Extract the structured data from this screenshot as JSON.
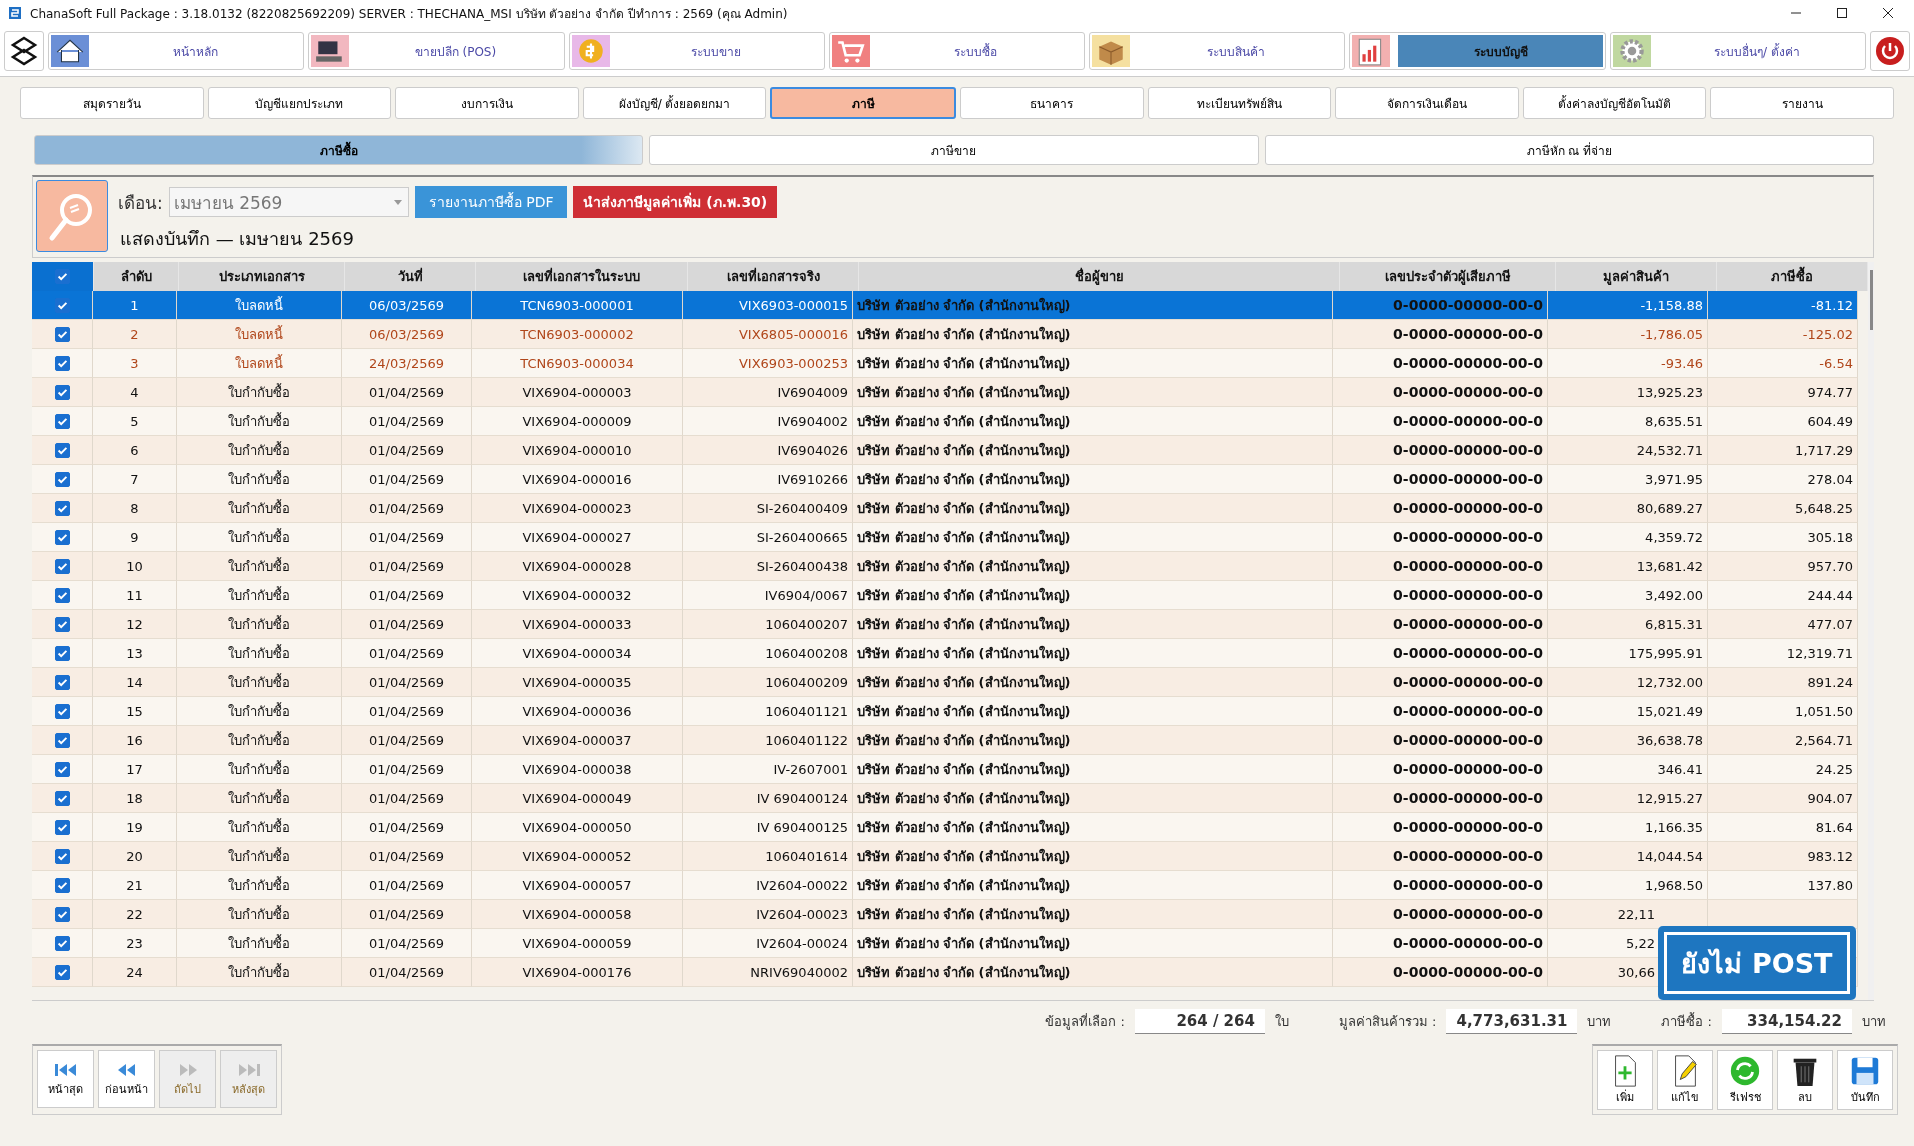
{
  "window": {
    "title": "ChanaSoft Full Package : 3.18.0132 (8220825692209) SERVER : THECHANA_MSI บริษัท ตัวอย่าง จำกัด ปีทำการ : 2569 (คุณ Admin)"
  },
  "modules": [
    {
      "label": "หน้าหลัก",
      "kind": "home",
      "selected": false
    },
    {
      "label": "ขายปลีก (POS)",
      "kind": "pos",
      "selected": false
    },
    {
      "label": "ระบบขาย",
      "kind": "sales",
      "selected": false
    },
    {
      "label": "ระบบซื้อ",
      "kind": "purchase",
      "selected": false
    },
    {
      "label": "ระบบสินค้า",
      "kind": "stock",
      "selected": false
    },
    {
      "label": "ระบบบัญชี",
      "kind": "account",
      "selected": true
    },
    {
      "label": "ระบบอื่นๆ/ ตั้งค่า",
      "kind": "settings",
      "selected": false
    }
  ],
  "sub_tabs": [
    {
      "label": "สมุดรายวัน",
      "selected": false
    },
    {
      "label": "บัญชีแยกประเภท",
      "selected": false
    },
    {
      "label": "งบการเงิน",
      "selected": false
    },
    {
      "label": "ผังบัญชี/ ตั้งยอดยกมา",
      "selected": false
    },
    {
      "label": "ภาษี",
      "selected": true
    },
    {
      "label": "ธนาคาร",
      "selected": false
    },
    {
      "label": "ทะเบียนทรัพย์สิน",
      "selected": false
    },
    {
      "label": "จัดการเงินเดือน",
      "selected": false
    },
    {
      "label": "ตั้งค่าลงบัญชีอัตโนมัติ",
      "selected": false
    },
    {
      "label": "รายงาน",
      "selected": false
    }
  ],
  "tax_tabs": [
    {
      "label": "ภาษีซื้อ",
      "selected": true
    },
    {
      "label": "ภาษีขาย",
      "selected": false
    },
    {
      "label": "ภาษีหัก ณ ที่จ่าย",
      "selected": false
    }
  ],
  "filter": {
    "month_label": "เดือน:",
    "month": "เมษายน 2569",
    "pdf_button": "รายงานภาษีซื้อ PDF",
    "submit_button": "นำส่งภาษีมูลค่าเพิ่ม (ภ.พ.30)",
    "heading": "แสดงบันทึก — เมษายน 2569"
  },
  "table": {
    "all_checked": true,
    "columns": [
      "ลำดับ",
      "ประเภทเอกสาร",
      "วันที่",
      "เลขที่เอกสารในระบบ",
      "เลขที่เอกสารจริง",
      "ชื่อผู้ขาย",
      "เลขประจำตัวผู้เสียภาษี",
      "มูลค่าสินค้า",
      "ภาษีซื้อ"
    ],
    "rows": [
      {
        "checked": true,
        "selected": true,
        "kind": "credit",
        "no": "1",
        "type": "ใบลดหนี้",
        "date": "06/03/2569",
        "doc": "TCN6903-000001",
        "ref": "VIX6903-000015",
        "vendor": "บริษัท ตัวอย่าง จำกัด (สำนักงานใหญ่)",
        "tax_id": "0-0000-00000-00-0",
        "amount": "-1,158.88",
        "vat": "-81.12"
      },
      {
        "checked": true,
        "selected": false,
        "kind": "credit",
        "no": "2",
        "type": "ใบลดหนี้",
        "date": "06/03/2569",
        "doc": "TCN6903-000002",
        "ref": "VIX6805-000016",
        "vendor": "บริษัท ตัวอย่าง จำกัด (สำนักงานใหญ่)",
        "tax_id": "0-0000-00000-00-0",
        "amount": "-1,786.05",
        "vat": "-125.02"
      },
      {
        "checked": true,
        "selected": false,
        "kind": "credit",
        "no": "3",
        "type": "ใบลดหนี้",
        "date": "24/03/2569",
        "doc": "TCN6903-000034",
        "ref": "VIX6903-000253",
        "vendor": "บริษัท ตัวอย่าง จำกัด (สำนักงานใหญ่)",
        "tax_id": "0-0000-00000-00-0",
        "amount": "-93.46",
        "vat": "-6.54"
      },
      {
        "checked": true,
        "selected": false,
        "kind": "invoice",
        "no": "4",
        "type": "ใบกำกับซื้อ",
        "date": "01/04/2569",
        "doc": "VIX6904-000003",
        "ref": "IV6904009",
        "vendor": "บริษัท ตัวอย่าง จำกัด (สำนักงานใหญ่)",
        "tax_id": "0-0000-00000-00-0",
        "amount": "13,925.23",
        "vat": "974.77"
      },
      {
        "checked": true,
        "selected": false,
        "kind": "invoice",
        "no": "5",
        "type": "ใบกำกับซื้อ",
        "date": "01/04/2569",
        "doc": "VIX6904-000009",
        "ref": "IV6904002",
        "vendor": "บริษัท ตัวอย่าง จำกัด (สำนักงานใหญ่)",
        "tax_id": "0-0000-00000-00-0",
        "amount": "8,635.51",
        "vat": "604.49"
      },
      {
        "checked": true,
        "selected": false,
        "kind": "invoice",
        "no": "6",
        "type": "ใบกำกับซื้อ",
        "date": "01/04/2569",
        "doc": "VIX6904-000010",
        "ref": "IV6904026",
        "vendor": "บริษัท ตัวอย่าง จำกัด (สำนักงานใหญ่)",
        "tax_id": "0-0000-00000-00-0",
        "amount": "24,532.71",
        "vat": "1,717.29"
      },
      {
        "checked": true,
        "selected": false,
        "kind": "invoice",
        "no": "7",
        "type": "ใบกำกับซื้อ",
        "date": "01/04/2569",
        "doc": "VIX6904-000016",
        "ref": "IV6910266",
        "vendor": "บริษัท ตัวอย่าง จำกัด (สำนักงานใหญ่)",
        "tax_id": "0-0000-00000-00-0",
        "amount": "3,971.95",
        "vat": "278.04"
      },
      {
        "checked": true,
        "selected": false,
        "kind": "invoice",
        "no": "8",
        "type": "ใบกำกับซื้อ",
        "date": "01/04/2569",
        "doc": "VIX6904-000023",
        "ref": "SI-260400409",
        "vendor": "บริษัท ตัวอย่าง จำกัด (สำนักงานใหญ่)",
        "tax_id": "0-0000-00000-00-0",
        "amount": "80,689.27",
        "vat": "5,648.25"
      },
      {
        "checked": true,
        "selected": false,
        "kind": "invoice",
        "no": "9",
        "type": "ใบกำกับซื้อ",
        "date": "01/04/2569",
        "doc": "VIX6904-000027",
        "ref": "SI-260400665",
        "vendor": "บริษัท ตัวอย่าง จำกัด (สำนักงานใหญ่)",
        "tax_id": "0-0000-00000-00-0",
        "amount": "4,359.72",
        "vat": "305.18"
      },
      {
        "checked": true,
        "selected": false,
        "kind": "invoice",
        "no": "10",
        "type": "ใบกำกับซื้อ",
        "date": "01/04/2569",
        "doc": "VIX6904-000028",
        "ref": "SI-260400438",
        "vendor": "บริษัท ตัวอย่าง จำกัด (สำนักงานใหญ่)",
        "tax_id": "0-0000-00000-00-0",
        "amount": "13,681.42",
        "vat": "957.70"
      },
      {
        "checked": true,
        "selected": false,
        "kind": "invoice",
        "no": "11",
        "type": "ใบกำกับซื้อ",
        "date": "01/04/2569",
        "doc": "VIX6904-000032",
        "ref": "IV6904/0067",
        "vendor": "บริษัท ตัวอย่าง จำกัด (สำนักงานใหญ่)",
        "tax_id": "0-0000-00000-00-0",
        "amount": "3,492.00",
        "vat": "244.44"
      },
      {
        "checked": true,
        "selected": false,
        "kind": "invoice",
        "no": "12",
        "type": "ใบกำกับซื้อ",
        "date": "01/04/2569",
        "doc": "VIX6904-000033",
        "ref": "1060400207",
        "vendor": "บริษัท ตัวอย่าง จำกัด (สำนักงานใหญ่)",
        "tax_id": "0-0000-00000-00-0",
        "amount": "6,815.31",
        "vat": "477.07"
      },
      {
        "checked": true,
        "selected": false,
        "kind": "invoice",
        "no": "13",
        "type": "ใบกำกับซื้อ",
        "date": "01/04/2569",
        "doc": "VIX6904-000034",
        "ref": "1060400208",
        "vendor": "บริษัท ตัวอย่าง จำกัด (สำนักงานใหญ่)",
        "tax_id": "0-0000-00000-00-0",
        "amount": "175,995.91",
        "vat": "12,319.71"
      },
      {
        "checked": true,
        "selected": false,
        "kind": "invoice",
        "no": "14",
        "type": "ใบกำกับซื้อ",
        "date": "01/04/2569",
        "doc": "VIX6904-000035",
        "ref": "1060400209",
        "vendor": "บริษัท ตัวอย่าง จำกัด (สำนักงานใหญ่)",
        "tax_id": "0-0000-00000-00-0",
        "amount": "12,732.00",
        "vat": "891.24"
      },
      {
        "checked": true,
        "selected": false,
        "kind": "invoice",
        "no": "15",
        "type": "ใบกำกับซื้อ",
        "date": "01/04/2569",
        "doc": "VIX6904-000036",
        "ref": "1060401121",
        "vendor": "บริษัท ตัวอย่าง จำกัด (สำนักงานใหญ่)",
        "tax_id": "0-0000-00000-00-0",
        "amount": "15,021.49",
        "vat": "1,051.50"
      },
      {
        "checked": true,
        "selected": false,
        "kind": "invoice",
        "no": "16",
        "type": "ใบกำกับซื้อ",
        "date": "01/04/2569",
        "doc": "VIX6904-000037",
        "ref": "1060401122",
        "vendor": "บริษัท ตัวอย่าง จำกัด (สำนักงานใหญ่)",
        "tax_id": "0-0000-00000-00-0",
        "amount": "36,638.78",
        "vat": "2,564.71"
      },
      {
        "checked": true,
        "selected": false,
        "kind": "invoice",
        "no": "17",
        "type": "ใบกำกับซื้อ",
        "date": "01/04/2569",
        "doc": "VIX6904-000038",
        "ref": "IV-2607001",
        "vendor": "บริษัท ตัวอย่าง จำกัด (สำนักงานใหญ่)",
        "tax_id": "0-0000-00000-00-0",
        "amount": "346.41",
        "vat": "24.25"
      },
      {
        "checked": true,
        "selected": false,
        "kind": "invoice",
        "no": "18",
        "type": "ใบกำกับซื้อ",
        "date": "01/04/2569",
        "doc": "VIX6904-000049",
        "ref": "IV 690400124",
        "vendor": "บริษัท ตัวอย่าง จำกัด (สำนักงานใหญ่)",
        "tax_id": "0-0000-00000-00-0",
        "amount": "12,915.27",
        "vat": "904.07"
      },
      {
        "checked": true,
        "selected": false,
        "kind": "invoice",
        "no": "19",
        "type": "ใบกำกับซื้อ",
        "date": "01/04/2569",
        "doc": "VIX6904-000050",
        "ref": "IV 690400125",
        "vendor": "บริษัท ตัวอย่าง จำกัด (สำนักงานใหญ่)",
        "tax_id": "0-0000-00000-00-0",
        "amount": "1,166.35",
        "vat": "81.64"
      },
      {
        "checked": true,
        "selected": false,
        "kind": "invoice",
        "no": "20",
        "type": "ใบกำกับซื้อ",
        "date": "01/04/2569",
        "doc": "VIX6904-000052",
        "ref": "1060401614",
        "vendor": "บริษัท ตัวอย่าง จำกัด (สำนักงานใหญ่)",
        "tax_id": "0-0000-00000-00-0",
        "amount": "14,044.54",
        "vat": "983.12"
      },
      {
        "checked": true,
        "selected": false,
        "kind": "invoice",
        "no": "21",
        "type": "ใบกำกับซื้อ",
        "date": "01/04/2569",
        "doc": "VIX6904-000057",
        "ref": "IV2604-00022",
        "vendor": "บริษัท ตัวอย่าง จำกัด (สำนักงานใหญ่)",
        "tax_id": "0-0000-00000-00-0",
        "amount": "1,968.50",
        "vat": "137.80"
      },
      {
        "checked": true,
        "selected": false,
        "kind": "invoice",
        "no": "22",
        "type": "ใบกำกับซื้อ",
        "date": "01/04/2569",
        "doc": "VIX6904-000058",
        "ref": "IV2604-00023",
        "vendor": "บริษัท ตัวอย่าง จำกัด (สำนักงานใหญ่)",
        "tax_id": "0-0000-00000-00-0",
        "amount": "22,11"
      },
      {
        "checked": true,
        "selected": false,
        "kind": "invoice",
        "no": "23",
        "type": "ใบกำกับซื้อ",
        "date": "01/04/2569",
        "doc": "VIX6904-000059",
        "ref": "IV2604-00024",
        "vendor": "บริษัท ตัวอย่าง จำกัด (สำนักงานใหญ่)",
        "tax_id": "0-0000-00000-00-0",
        "amount": "5,22"
      },
      {
        "checked": true,
        "selected": false,
        "kind": "invoice",
        "no": "24",
        "type": "ใบกำกับซื้อ",
        "date": "01/04/2569",
        "doc": "VIX6904-000176",
        "ref": "NRIV69040002",
        "vendor": "บริษัท ตัวอย่าง จำกัด (สำนักงานใหญ่)",
        "tax_id": "0-0000-00000-00-0",
        "amount": "30,66"
      }
    ]
  },
  "status_badge": "ยังไม่ POST",
  "totals": [
    {
      "label": "ข้อมูลที่เลือก :",
      "value": "264 / 264",
      "unit": "ใบ"
    },
    {
      "label": "มูลค่าสินค้ารวม :",
      "value": "4,773,631.31",
      "unit": "บาท"
    },
    {
      "label": "ภาษีซื้อ :",
      "value": "334,154.22",
      "unit": "บาท"
    }
  ],
  "nav_buttons": [
    {
      "label": "หน้าสุด",
      "kind": "first",
      "disabled": false
    },
    {
      "label": "ก่อนหน้า",
      "kind": "prev",
      "disabled": false
    },
    {
      "label": "ถัดไป",
      "kind": "next",
      "disabled": true
    },
    {
      "label": "หลังสุด",
      "kind": "last",
      "disabled": true
    }
  ],
  "actions": [
    {
      "label": "เพิ่ม",
      "kind": "add"
    },
    {
      "label": "แก้ไข",
      "kind": "edit"
    },
    {
      "label": "รีเฟรช",
      "kind": "refresh"
    },
    {
      "label": "ลบ",
      "kind": "delete"
    },
    {
      "label": "บันทึก",
      "kind": "save"
    }
  ]
}
